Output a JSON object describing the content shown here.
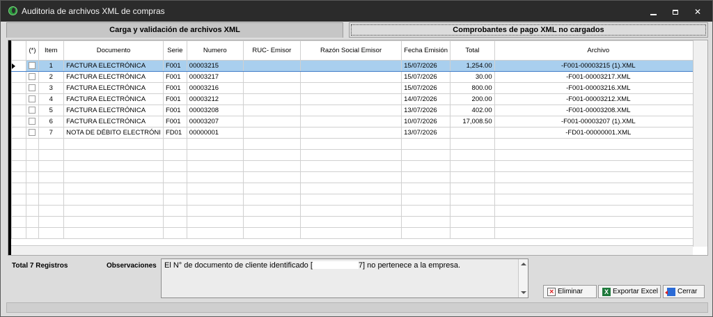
{
  "window": {
    "title": "Auditoria de archivos XML de compras",
    "controls": {
      "minimize": "minimize",
      "maximize": "maximize",
      "close": "✕"
    }
  },
  "tabs": [
    {
      "label": "Carga y validación de archivos XML"
    },
    {
      "label": "Comprobantes de pago XML no cargados"
    }
  ],
  "grid": {
    "columns": [
      "(*)",
      "Item",
      "Documento",
      "Serie",
      "Numero",
      "RUC- Emisor",
      "Razón Social Emisor",
      "Fecha Emisión",
      "Total",
      "Archivo"
    ],
    "rows": [
      {
        "item": "1",
        "documento": "FACTURA ELECTRÓNICA",
        "serie": "F001",
        "numero": "00003215",
        "ruc": "",
        "razon": "",
        "fecha": "15/07/2026",
        "total": "1,254.00",
        "archivo": "-F001-00003215 (1).XML"
      },
      {
        "item": "2",
        "documento": "FACTURA ELECTRÓNICA",
        "serie": "F001",
        "numero": "00003217",
        "ruc": "",
        "razon": "",
        "fecha": "15/07/2026",
        "total": "30.00",
        "archivo": "-F001-00003217.XML"
      },
      {
        "item": "3",
        "documento": "FACTURA ELECTRÓNICA",
        "serie": "F001",
        "numero": "00003216",
        "ruc": "",
        "razon": "",
        "fecha": "15/07/2026",
        "total": "800.00",
        "archivo": "-F001-00003216.XML"
      },
      {
        "item": "4",
        "documento": "FACTURA ELECTRÓNICA",
        "serie": "F001",
        "numero": "00003212",
        "ruc": "",
        "razon": "",
        "fecha": "14/07/2026",
        "total": "200.00",
        "archivo": "-F001-00003212.XML"
      },
      {
        "item": "5",
        "documento": "FACTURA ELECTRÓNICA",
        "serie": "F001",
        "numero": "00003208",
        "ruc": "",
        "razon": "",
        "fecha": "13/07/2026",
        "total": "402.00",
        "archivo": "-F001-00003208.XML"
      },
      {
        "item": "6",
        "documento": "FACTURA ELECTRÓNICA",
        "serie": "F001",
        "numero": "00003207",
        "ruc": "",
        "razon": "",
        "fecha": "10/07/2026",
        "total": "17,008.50",
        "archivo": "-F001-00003207 (1).XML"
      },
      {
        "item": "7",
        "documento": "NOTA DE DÉBITO ELECTRÓNI",
        "serie": "FD01",
        "numero": "00000001",
        "ruc": "",
        "razon": "",
        "fecha": "13/07/2026",
        "total": "",
        "archivo": "-FD01-00000001.XML"
      }
    ]
  },
  "footer": {
    "total_label": "Total 7 Registros",
    "obs_label": "Observaciones",
    "obs_text_before": "El N° de documento de cliente identificado [",
    "obs_text_after": "7] no pertenece a la empresa."
  },
  "buttons": {
    "eliminar": "Eliminar",
    "exportar": "Exportar Excel",
    "cerrar": "Cerrar"
  }
}
